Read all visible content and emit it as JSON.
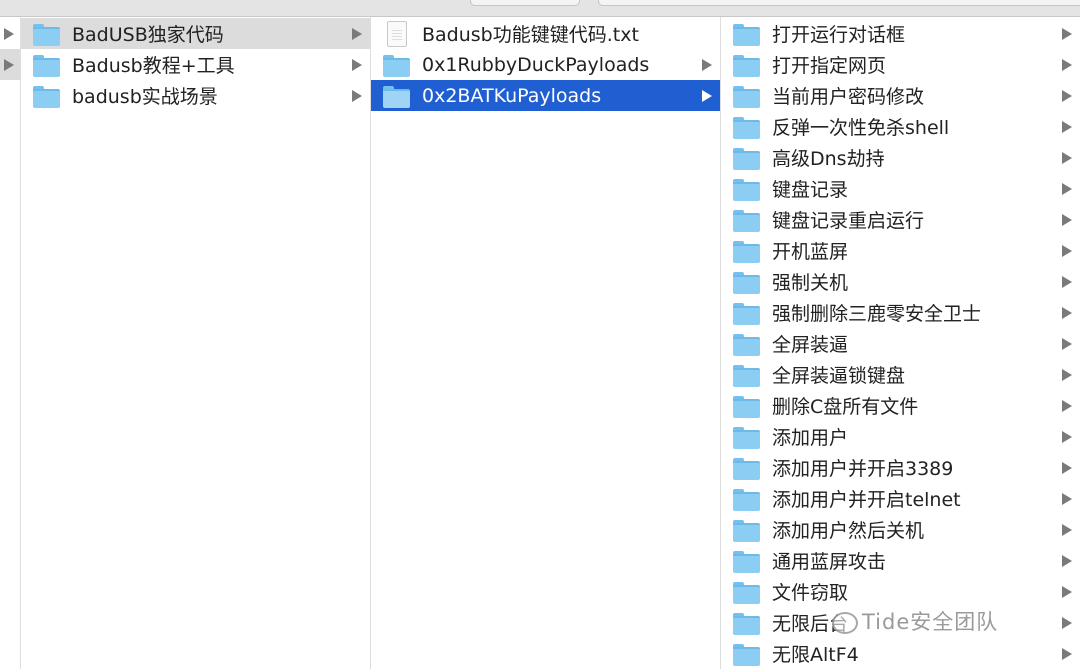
{
  "column0": {
    "rows": [
      {
        "selected": false
      },
      {
        "selected": true
      }
    ]
  },
  "column1": {
    "items": [
      {
        "label": "BadUSB独家代码",
        "type": "folder",
        "selected": "gray"
      },
      {
        "label": "Badusb教程+工具",
        "type": "folder"
      },
      {
        "label": "badusb实战场景",
        "type": "folder"
      }
    ]
  },
  "column2": {
    "items": [
      {
        "label": "Badusb功能键键代码.txt",
        "type": "file"
      },
      {
        "label": "0x1RubbyDuckPayloads",
        "type": "folder"
      },
      {
        "label": "0x2BATKuPayloads",
        "type": "folder",
        "selected": "blue"
      }
    ]
  },
  "column3": {
    "items": [
      {
        "label": "打开运行对话框"
      },
      {
        "label": "打开指定网页"
      },
      {
        "label": "当前用户密码修改"
      },
      {
        "label": "反弹一次性免杀shell"
      },
      {
        "label": "高级Dns劫持"
      },
      {
        "label": "键盘记录"
      },
      {
        "label": "键盘记录重启运行"
      },
      {
        "label": "开机蓝屏"
      },
      {
        "label": "强制关机"
      },
      {
        "label": "强制删除三鹿零安全卫士"
      },
      {
        "label": "全屏装逼"
      },
      {
        "label": "全屏装逼锁键盘"
      },
      {
        "label": "删除C盘所有文件"
      },
      {
        "label": "添加用户"
      },
      {
        "label": "添加用户并开启3389"
      },
      {
        "label": "添加用户并开启telnet"
      },
      {
        "label": "添加用户然后关机"
      },
      {
        "label": "通用蓝屏攻击"
      },
      {
        "label": "文件窃取"
      },
      {
        "label": "无限后台"
      },
      {
        "label": "无限AltF4"
      }
    ]
  },
  "watermark": "Tide安全团队",
  "colors": {
    "selection_blue": "#1f5fd1",
    "selection_gray": "#dcdcdc",
    "folder": "#8ccdf3"
  }
}
